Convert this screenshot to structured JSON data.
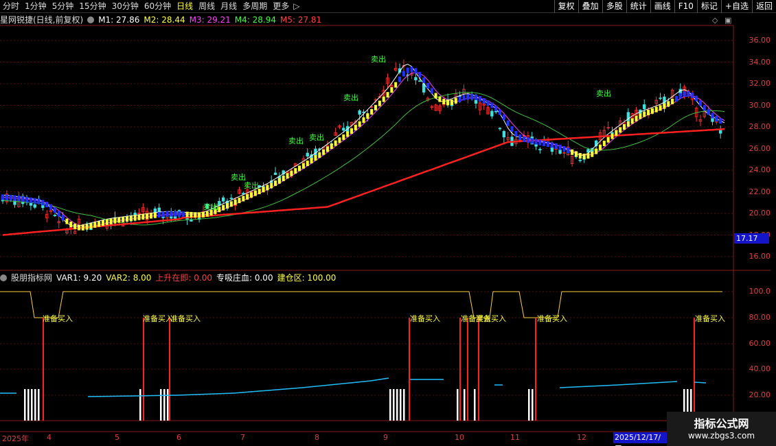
{
  "toolbar": {
    "periods": [
      "分时",
      "1分钟",
      "5分钟",
      "15分钟",
      "30分钟",
      "60分钟",
      "日线",
      "周线",
      "月线",
      "多周期",
      "更多"
    ],
    "active_period": "日线",
    "tools": [
      "复权",
      "叠加",
      "多股",
      "统计",
      "画线",
      "F10",
      "标记",
      "+自选",
      "返回"
    ]
  },
  "main_legend": {
    "stock": "星网锐捷(日线,前复权)",
    "ma": [
      {
        "label": "M1: 27.86",
        "color": "#ffffff"
      },
      {
        "label": "M2: 28.44",
        "color": "#ffff40"
      },
      {
        "label": "M3: 29.21",
        "color": "#ff40ff"
      },
      {
        "label": "M4: 28.94",
        "color": "#40ff40"
      },
      {
        "label": "M5: 27.81",
        "color": "#ff4040"
      }
    ]
  },
  "sub_legend": {
    "name": "股朋指标网",
    "items": [
      {
        "label": "VAR1: 9.20",
        "color": "#ffffff"
      },
      {
        "label": "VAR2: 8.00",
        "color": "#ffff40"
      },
      {
        "label": "上升在即: 0.00",
        "color": "#ff4040"
      },
      {
        "label": "专吸庄血: 0.00",
        "color": "#ffffff"
      },
      {
        "label": "建仓区: 100.00",
        "color": "#ffff40"
      }
    ]
  },
  "price_axis": [
    "36.00",
    "34.00",
    "32.00",
    "30.00",
    "28.00",
    "26.00",
    "24.00",
    "22.00",
    "20.00",
    "18.00",
    "16.00"
  ],
  "sub_axis": [
    "100.0",
    "80.00",
    "60.00",
    "40.00",
    "20.00"
  ],
  "current_price": "17.17",
  "x_axis": [
    "2025年",
    "4",
    "5",
    "6",
    "7",
    "8",
    "9",
    "10",
    "11",
    "12"
  ],
  "date_cursor": "2025/12/17/三",
  "annotations": {
    "prepare_buy": "准备买入",
    "sell": "卖出"
  },
  "watermark": {
    "line1": "指标公式网",
    "line2": "www.zbgs3.com"
  },
  "chart_data": {
    "type": "line",
    "title": "星网锐捷(日线,前复权)",
    "ylim": [
      15,
      37
    ],
    "x": [
      "2025-03",
      "2025-04",
      "2025-05",
      "2025-06",
      "2025-07",
      "2025-08",
      "2025-09",
      "2025-10",
      "2025-11",
      "2025-12"
    ],
    "series": [
      {
        "name": "M1",
        "values": [
          21.5,
          20.0,
          19.8,
          20.0,
          24.0,
          29.0,
          33.0,
          27.0,
          26.0,
          27.86
        ]
      },
      {
        "name": "M5",
        "values": [
          18.0,
          18.8,
          19.5,
          20.0,
          20.5,
          21.5,
          24.0,
          26.0,
          27.0,
          27.81
        ]
      }
    ]
  }
}
